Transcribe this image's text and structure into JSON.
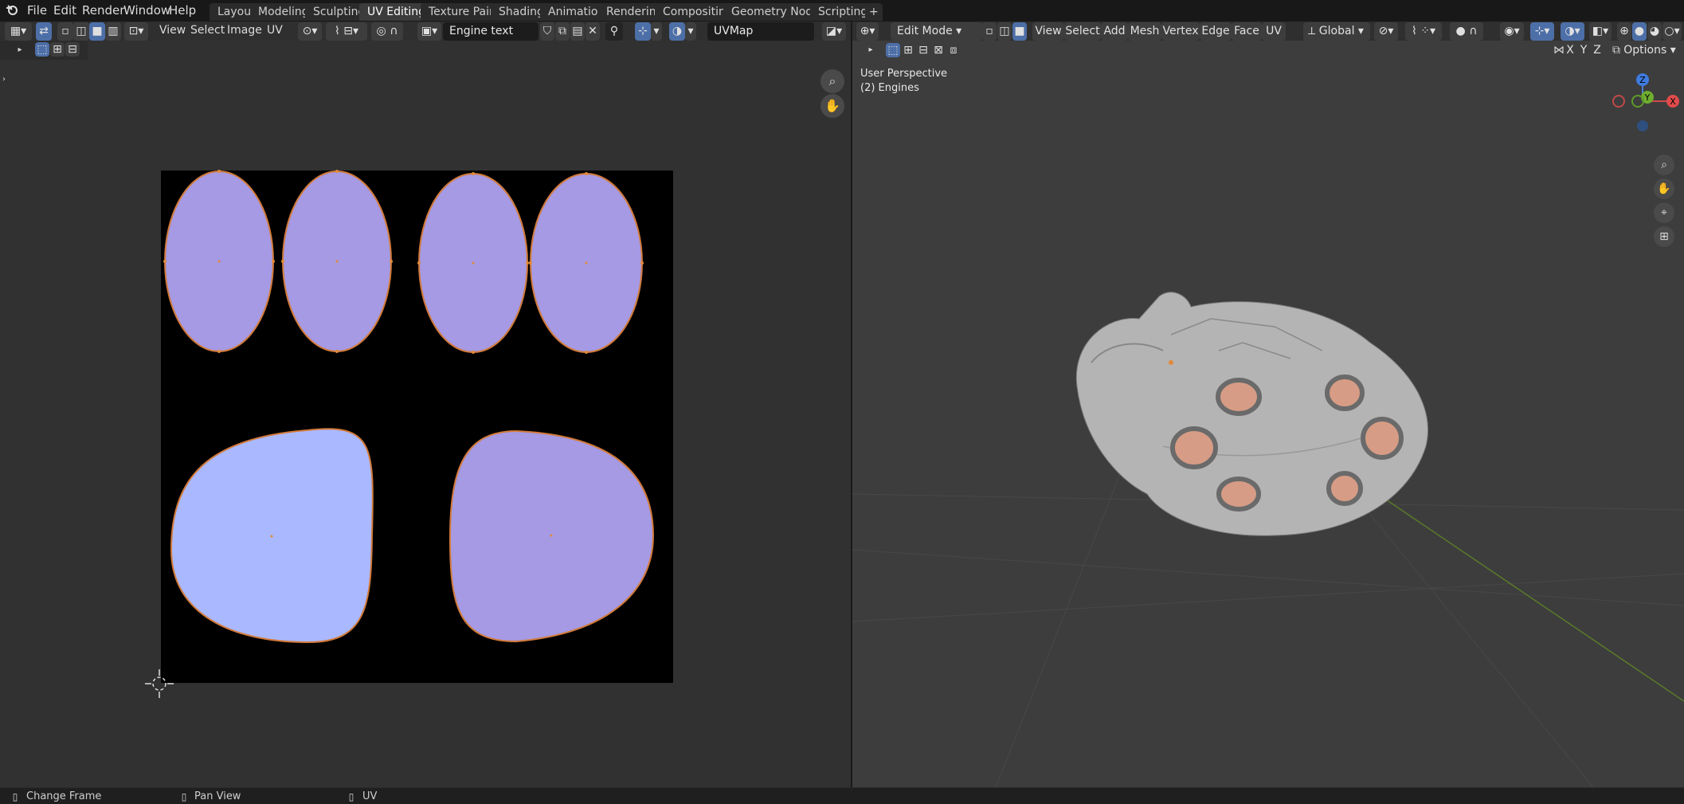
{
  "menu": [
    "File",
    "Edit",
    "Render",
    "Window",
    "Help"
  ],
  "workspace_tabs": [
    "Layout",
    "Modeling",
    "Sculpting",
    "UV Editing",
    "Texture Paint",
    "Shading",
    "Animation",
    "Rendering",
    "Compositing",
    "Geometry Nodes",
    "Scripting"
  ],
  "active_tab": "UV Editing",
  "uv_editor": {
    "menus": [
      "View",
      "Select",
      "Image",
      "UV"
    ],
    "image_name": "Engine text",
    "uv_map": "UVMap"
  },
  "viewport": {
    "mode": "Edit Mode",
    "menus": [
      "View",
      "Select",
      "Add",
      "Mesh",
      "Vertex",
      "Edge",
      "Face",
      "UV"
    ],
    "orientation": "Global",
    "options_label": "Options",
    "axis_buttons": [
      "X",
      "Y",
      "Z"
    ],
    "perspective_label": "User Perspective",
    "object_label": "(2) Engines",
    "gizmo_labels": [
      "Z",
      "Y",
      "X"
    ]
  },
  "status": {
    "items": [
      "Change Frame",
      "Pan View",
      "UV"
    ]
  },
  "colors": {
    "uv_face_selected": "#a59ae3",
    "uv_face_active": "#aab9ff",
    "uv_edge": "#d27a3a",
    "ship_body": "#b4b4b4",
    "engine_glow": "#d79c85",
    "viewport_bg": "#3d3d3d",
    "uv_bg": "#313131"
  },
  "icons": [
    "blender-logo-icon",
    "editor-type-icon",
    "sync-selection-icon",
    "select-mode-icons",
    "pivot-icon",
    "snap-icon",
    "proportional-icon",
    "image-browse-icon",
    "new-image-icon",
    "open-image-icon",
    "unlink-icon",
    "pin-icon",
    "overlay-icon",
    "zoom-icon",
    "hand-pan-icon",
    "camera-icon",
    "grid-view-icon",
    "shading-icons"
  ]
}
